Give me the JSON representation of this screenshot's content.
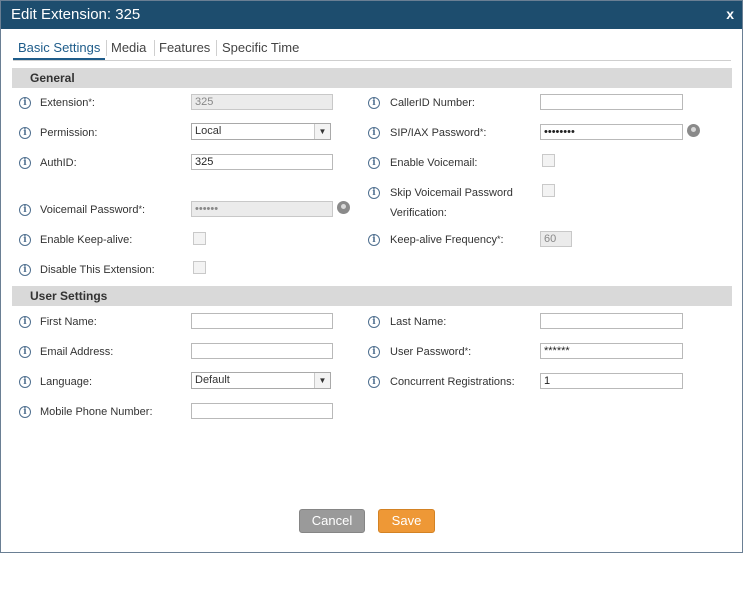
{
  "window": {
    "title": "Edit Extension: 325",
    "close_label": "x"
  },
  "tabs": [
    "Basic Settings",
    "Media",
    "Features",
    "Specific Time"
  ],
  "sections": {
    "general": "General",
    "user": "User Settings"
  },
  "general": {
    "extension": {
      "label": "Extension",
      "value": "325"
    },
    "permission": {
      "label": "Permission:",
      "value": "Local"
    },
    "authid": {
      "label": "AuthID:",
      "value": "325"
    },
    "voicemail_password": {
      "label": "Voicemail Password",
      "value": "••••••"
    },
    "keep_alive": {
      "label": "Enable Keep-alive:"
    },
    "disable_ext": {
      "label": "Disable This Extension:"
    },
    "callerid": {
      "label": "CallerID Number:",
      "value": ""
    },
    "sip_password": {
      "label": "SIP/IAX Password",
      "value": "••••••••"
    },
    "enable_voicemail": {
      "label": "Enable Voicemail:"
    },
    "skip_vm_line1": "Skip Voicemail Password",
    "skip_vm_line2": "Verification:",
    "keep_alive_freq": {
      "label": "Keep-alive Frequency",
      "value": "60"
    }
  },
  "user": {
    "first_name": {
      "label": "First Name:",
      "value": ""
    },
    "email": {
      "label": "Email Address:",
      "value": ""
    },
    "language": {
      "label": "Language:",
      "value": "Default"
    },
    "mobile": {
      "label": "Mobile Phone Number:",
      "value": ""
    },
    "last_name": {
      "label": "Last Name:",
      "value": ""
    },
    "user_password": {
      "label": "User Password",
      "value": "******"
    },
    "concurrent": {
      "label": "Concurrent Registrations:",
      "value": "1"
    }
  },
  "buttons": {
    "cancel": "Cancel",
    "save": "Save"
  },
  "symbols": {
    "required": "*",
    "colon": ":",
    "info": "i",
    "dropdown": "▼"
  },
  "colors": {
    "titlebar": "#1d4d6e",
    "accent": "#1e5c8a",
    "save": "#ee9836",
    "cancel": "#9a9a9a"
  }
}
